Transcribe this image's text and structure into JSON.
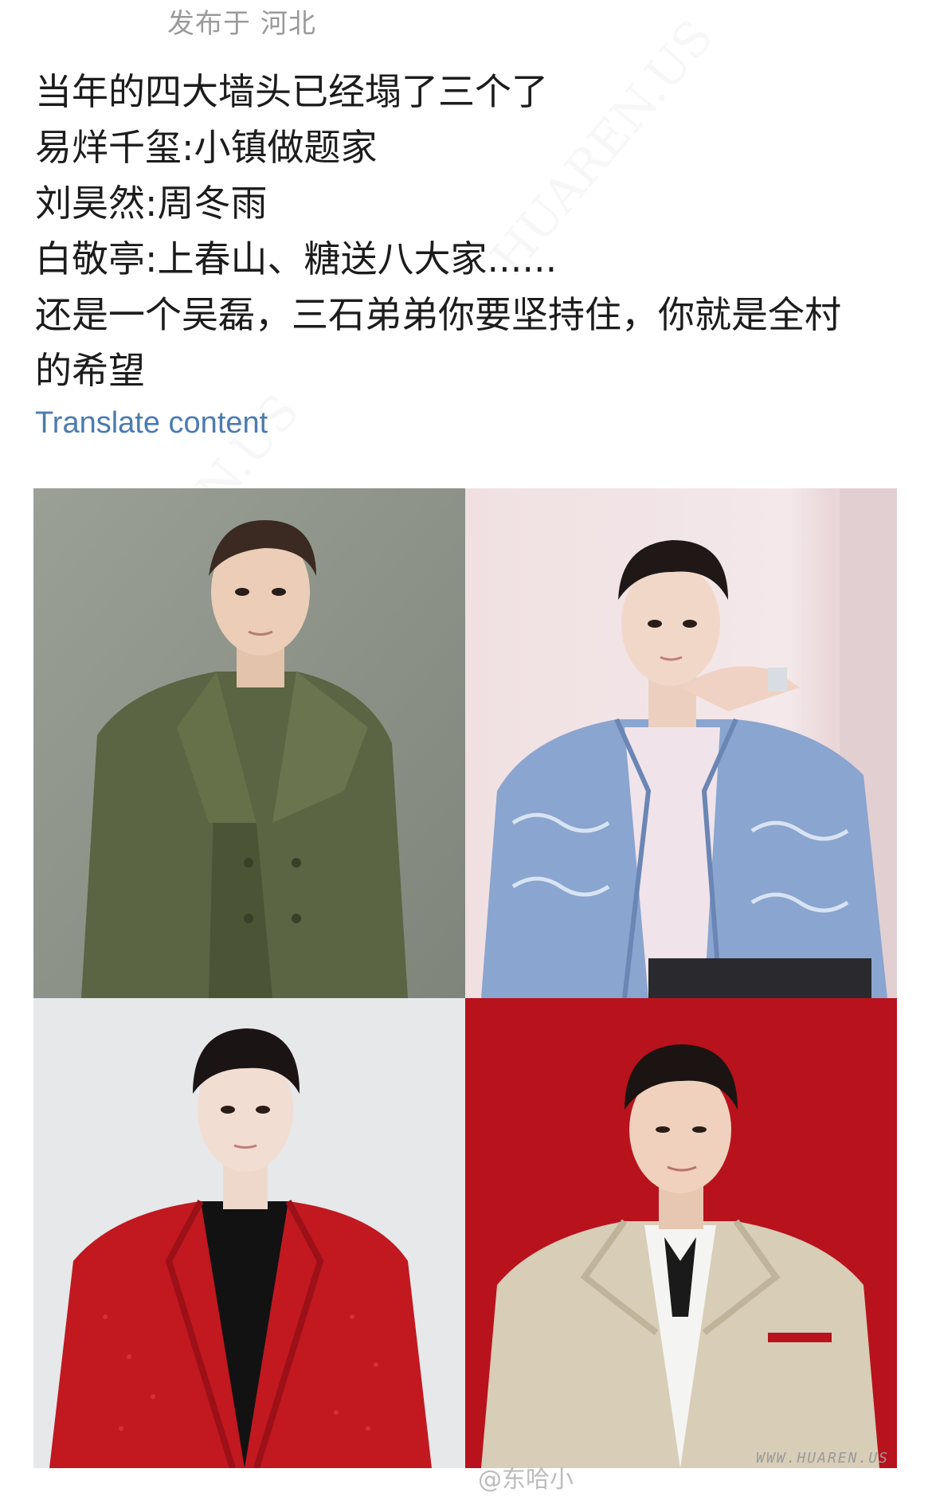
{
  "header": {
    "posted_prefix": "发布于",
    "location": "河北"
  },
  "post": {
    "lines": [
      "当年的四大墙头已经塌了三个了",
      "易烊千玺:小镇做题家",
      "刘昊然:周冬雨",
      "白敬亭:上春山、糖送八大家......",
      "还是一个吴磊，三石弟弟你要坚持住，你就是全村",
      "的希望"
    ],
    "translate_label": "Translate content"
  },
  "photos": [
    {
      "subject": "man in olive green double-breasted coat",
      "bg": "#8f958a"
    },
    {
      "subject": "man in blue patterned jacket, hand at chin",
      "bg": "#ecdede"
    },
    {
      "subject": "man in red sparkly jacket with black turtleneck",
      "bg": "#e6e8ea"
    },
    {
      "subject": "man in beige jacket with black neck scarf",
      "bg": "#b8121d"
    }
  ],
  "footer": {
    "photo_credit": "@东哈小",
    "site_watermark": "WWW.HUAREN.US"
  },
  "colors": {
    "link": "#4a7bb0",
    "muted": "#9a9a9a",
    "text": "#1c1c1c"
  }
}
